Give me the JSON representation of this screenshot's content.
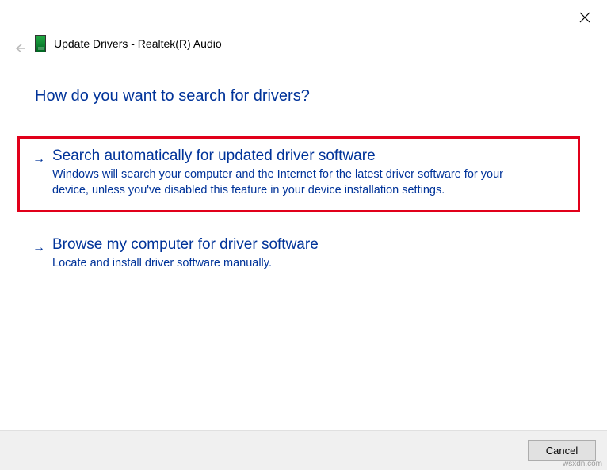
{
  "window": {
    "title": "Update Drivers - Realtek(R) Audio"
  },
  "prompt": "How do you want to search for drivers?",
  "options": {
    "auto": {
      "title": "Search automatically for updated driver software",
      "description": "Windows will search your computer and the Internet for the latest driver software for your device, unless you've disabled this feature in your device installation settings."
    },
    "browse": {
      "title": "Browse my computer for driver software",
      "description": "Locate and install driver software manually."
    }
  },
  "footer": {
    "cancel_label": "Cancel"
  },
  "watermark": "wsxdn.com"
}
